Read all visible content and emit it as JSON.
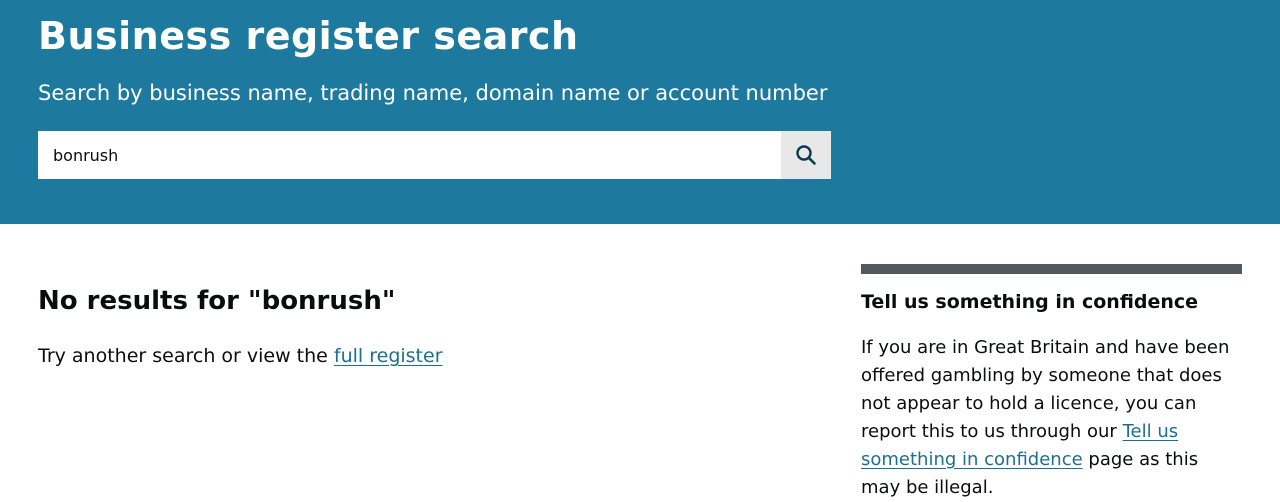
{
  "header": {
    "title": "Business register search",
    "subtitle": "Search by business name, trading name, domain name or account number"
  },
  "search": {
    "value": "bonrush",
    "button_icon": "search-icon"
  },
  "results": {
    "heading": "No results for \"bonrush\"",
    "try_text": "Try another search or view the",
    "full_register_link": "full register"
  },
  "aside": {
    "heading": "Tell us something in confidence",
    "text_before": "If you are in Great Britain and have been offered gambling by someone that does not appear to hold a licence, you can report this to us through our",
    "link": "Tell us something in confidence",
    "text_after": "page as this may be illegal."
  },
  "colors": {
    "header_bg": "#1d799e",
    "link": "#1d6f8f",
    "aside_bar": "#505a5f",
    "search_button_bg": "#e8e8e8"
  }
}
